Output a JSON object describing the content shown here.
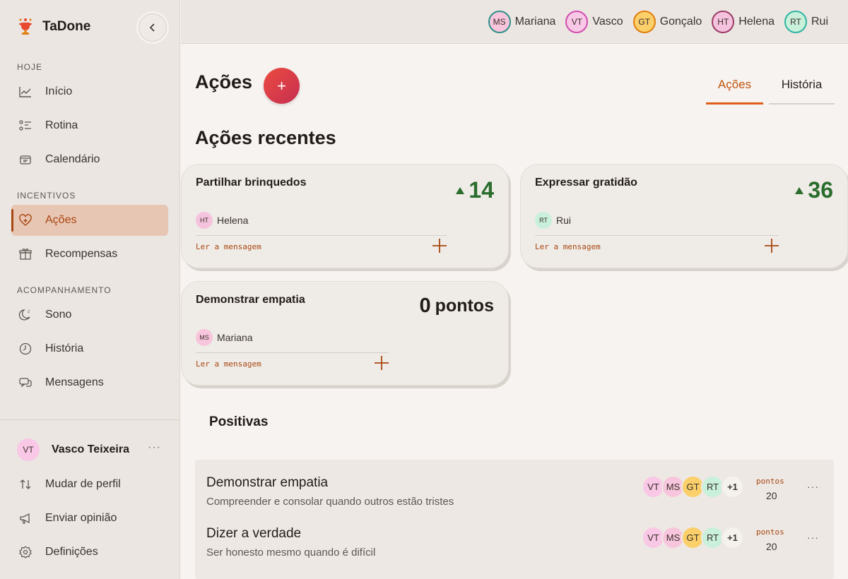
{
  "app": {
    "name": "TaDone"
  },
  "sidebar": {
    "sections": [
      {
        "title": "HOJE"
      },
      {
        "title": "INCENTIVOS"
      },
      {
        "title": "ACOMPANHAMENTO"
      }
    ],
    "items": [
      {
        "label": "Início",
        "icon": "chart-line-icon"
      },
      {
        "label": "Rotina",
        "icon": "checklist-icon"
      },
      {
        "label": "Calendário",
        "icon": "calendar-icon"
      },
      {
        "label": "Ações",
        "icon": "heart-plus-icon",
        "active": true
      },
      {
        "label": "Recompensas",
        "icon": "gift-icon"
      },
      {
        "label": "Sono",
        "icon": "moon-icon"
      },
      {
        "label": "História",
        "icon": "clock-icon"
      },
      {
        "label": "Mensagens",
        "icon": "chat-icon"
      }
    ],
    "profile": {
      "initials": "VT",
      "name": "Vasco Teixeira",
      "more": "···"
    },
    "footer": [
      {
        "label": "Mudar de perfil",
        "icon": "swap-icon"
      },
      {
        "label": "Enviar opinião",
        "icon": "megaphone-icon"
      },
      {
        "label": "Definições",
        "icon": "gear-icon"
      }
    ]
  },
  "topbar": {
    "members": [
      {
        "initials": "MS",
        "name": "Mariana"
      },
      {
        "initials": "VT",
        "name": "Vasco"
      },
      {
        "initials": "GT",
        "name": "Gonçalo"
      },
      {
        "initials": "HT",
        "name": "Helena"
      },
      {
        "initials": "RT",
        "name": "Rui"
      }
    ]
  },
  "main": {
    "title": "Ações",
    "add_label": "+",
    "tabs": [
      {
        "label": "Ações",
        "active": true
      },
      {
        "label": "História"
      }
    ],
    "recent_title": "Ações recentes",
    "recent": [
      {
        "title": "Partilhar brinquedos",
        "score": "14",
        "initials": "HT",
        "person": "Helena",
        "link": "Ler a mensagem"
      },
      {
        "title": "Expressar gratidão",
        "score": "36",
        "initials": "RT",
        "person": "Rui",
        "link": "Ler a mensagem"
      },
      {
        "title": "Demonstrar empatia",
        "score": "0",
        "unit": "pontos",
        "initials": "MS",
        "person": "Mariana",
        "link": "Ler a mensagem"
      }
    ],
    "positive_title": "Positivas",
    "positive": [
      {
        "title": "Demonstrar empatia",
        "description": "Compreender e consolar quando outros estão tristes",
        "avatars": [
          "VT",
          "MS",
          "GT",
          "RT"
        ],
        "more": "+1",
        "points_label": "pontos",
        "points": "20",
        "menu": "···"
      },
      {
        "title": "Dizer a verdade",
        "description": "Ser honesto mesmo quando é difícil",
        "avatars": [
          "VT",
          "MS",
          "GT",
          "RT"
        ],
        "more": "+1",
        "points_label": "pontos",
        "points": "20",
        "menu": "···"
      }
    ]
  },
  "colors": {
    "accent": "#c0550e",
    "active_bg": "#e8c6b4",
    "positive": "#2a6d2c",
    "add_button": "#e0424a"
  }
}
